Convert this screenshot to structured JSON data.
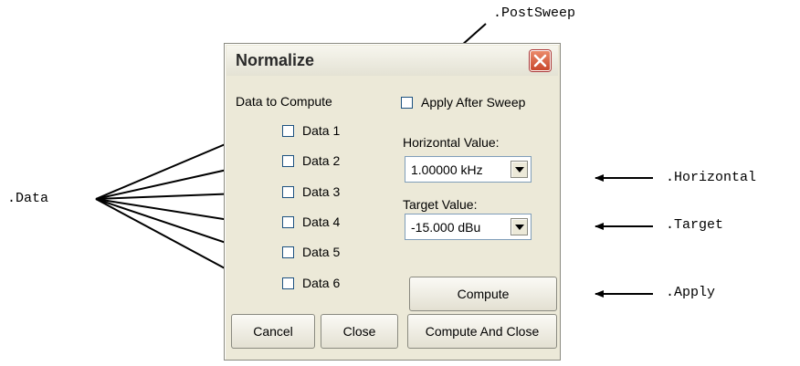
{
  "annotations": {
    "data": ".Data",
    "post_sweep": ".PostSweep",
    "horizontal": ".Horizontal",
    "target": ".Target",
    "apply": ".Apply"
  },
  "dialog": {
    "title": "Normalize",
    "data_to_compute_label": "Data to Compute",
    "apply_after_sweep_label": "Apply After Sweep",
    "data_items": [
      {
        "label": "Data 1",
        "checked": false
      },
      {
        "label": "Data 2",
        "checked": false
      },
      {
        "label": "Data 3",
        "checked": false
      },
      {
        "label": "Data 4",
        "checked": false
      },
      {
        "label": "Data 5",
        "checked": false
      },
      {
        "label": "Data 6",
        "checked": false
      }
    ],
    "horizontal_value_label": "Horizontal Value:",
    "horizontal_value": "1.00000 kHz",
    "target_value_label": "Target Value:",
    "target_value": "-15.000  dBu",
    "compute_label": "Compute",
    "cancel_label": "Cancel",
    "close_label": "Close",
    "compute_and_close_label": "Compute And Close"
  },
  "colors": {
    "dialog_bg": "#ece9d8",
    "close_button": "#d65d3c",
    "checkbox_border": "#1c5180"
  }
}
